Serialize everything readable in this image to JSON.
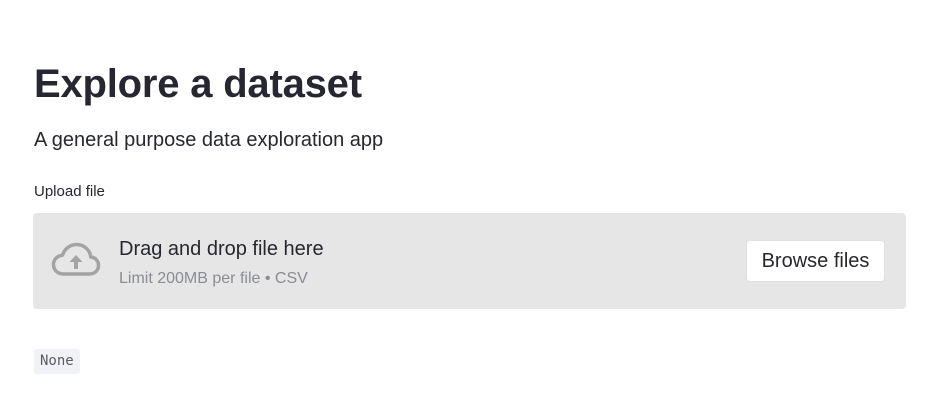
{
  "header": {
    "title": "Explore a dataset",
    "subtitle": "A general purpose data exploration app"
  },
  "uploader": {
    "label": "Upload file",
    "drop_text": "Drag and drop file here",
    "limit_text": "Limit 200MB per file • CSV",
    "browse_label": "Browse files",
    "icon": "cloud-upload-icon"
  },
  "output": {
    "value": "None"
  },
  "colors": {
    "text": "#262730",
    "dropzone_bg": "#e6e6e6",
    "muted_text": "#8a8c94",
    "icon": "#a3a3a3"
  }
}
